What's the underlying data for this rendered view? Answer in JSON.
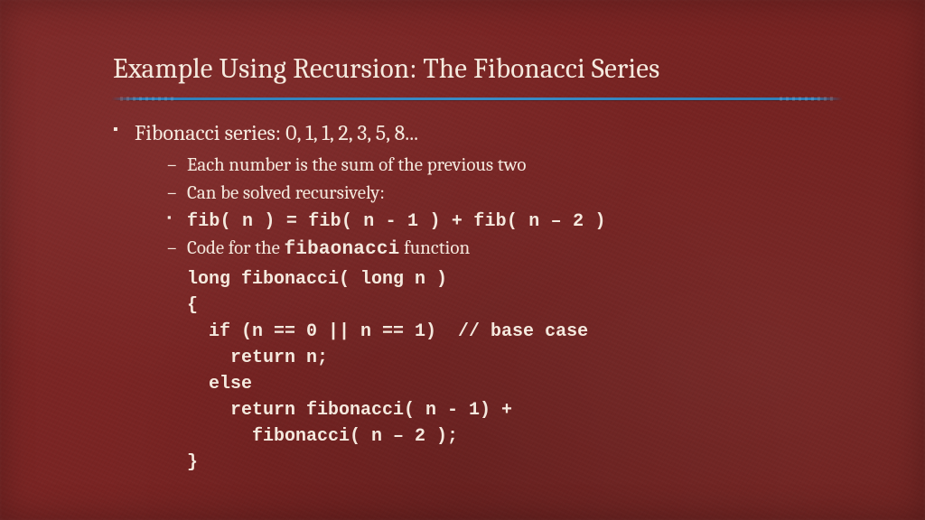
{
  "title": "Example Using Recursion: The Fibonacci Series",
  "bullets": {
    "main": "Fibonacci series: 0, 1, 1, 2, 3, 5, 8...",
    "sub1": "Each number is the sum of the previous two",
    "sub2": "Can be solved recursively:",
    "formula": "fib( n ) = fib( n - 1 ) + fib( n – 2 )",
    "sub3_pre": "Code for the ",
    "sub3_code": "fibaonacci",
    "sub3_post": " function"
  },
  "code": {
    "l1": "long fibonacci( long n )",
    "l2": "{",
    "l3": "  if (n == 0 || n == 1)  // base case",
    "l4": "    return n;",
    "l5": "  else",
    "l6": "    return fibonacci( n - 1) +",
    "l7": "      fibonacci( n – 2 );",
    "l8": "}"
  }
}
